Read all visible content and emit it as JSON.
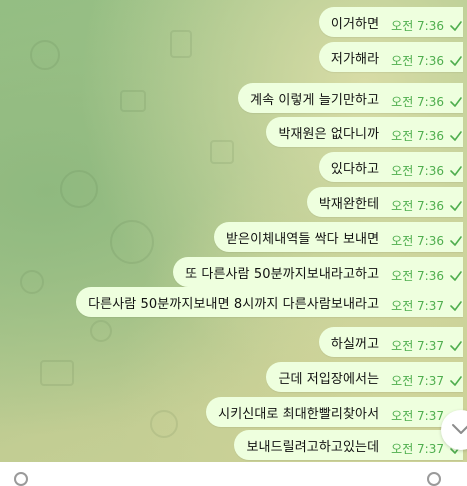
{
  "messages": [
    {
      "text": "이거하면",
      "time": "오전 7:36"
    },
    {
      "text": "저가해라",
      "time": "오전 7:36"
    },
    {
      "text": "계속 이렇게 늘기만하고",
      "time": "오전 7:36"
    },
    {
      "text": "박재원은 없다니까",
      "time": "오전 7:36"
    },
    {
      "text": "있다하고",
      "time": "오전 7:36"
    },
    {
      "text": "박재완한테",
      "time": "오전 7:36"
    },
    {
      "text": "받은이체내역들 싹다 보내면",
      "time": "오전 7:36"
    },
    {
      "text": "또 다른사람 50분까지보내라고하고",
      "time": "오전 7:36"
    },
    {
      "text": "다른사람 50분까지보내면 8시까지 다른사람보내라고",
      "time": "오전 7:37"
    },
    {
      "text": "하실꺼고",
      "time": "오전 7:37"
    },
    {
      "text": "근데 저입장에서는",
      "time": "오전 7:37"
    },
    {
      "text": "시키신대로 최대한빨리찾아서",
      "time": "오전 7:37"
    },
    {
      "text": "보내드릴려고하고있는데",
      "time": "오전 7:37"
    }
  ],
  "colors": {
    "bubble": "#eeffde",
    "time": "#4fae4e",
    "read_check": "#4fae4e"
  },
  "icons": {
    "read_receipt": "single-check-icon",
    "scroll_down": "chevron-down-icon"
  }
}
